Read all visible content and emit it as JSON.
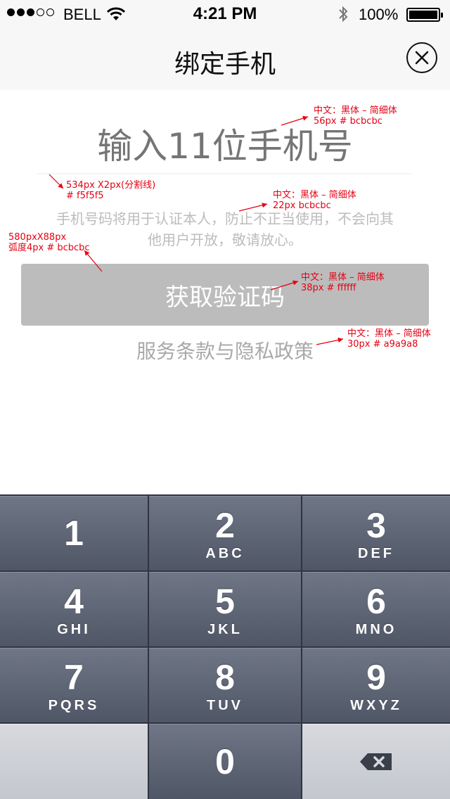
{
  "status_bar": {
    "carrier": "BELL",
    "time": "4:21 PM",
    "battery": "100%",
    "signal_bars": 3,
    "signal_total": 5
  },
  "nav": {
    "title": "绑定手机",
    "close_icon": "close-circle-icon"
  },
  "form": {
    "phone_placeholder": "输入11位手机号",
    "notice_line1": "手机号码将用于认证本人，防止不正当使用，不会向其",
    "notice_line2": "他用户开放，敬请放心。",
    "get_code_label": "获取验证码",
    "terms_label": "服务条款与隐私政策"
  },
  "annotations": {
    "input_line1": "中文：黑体 – 简细体",
    "input_line2": "56px    # bcbcbc",
    "divider_line1": "534px X2px(分割线)",
    "divider_line2": "# f5f5f5",
    "notice_line1": "中文：黑体 – 简细体",
    "notice_line2": "22px     bcbcbc",
    "button_line1": "580pxX88px",
    "button_line2": "弧度4px  # bcbcbc",
    "btn_text_line1": "中文：黑体 – 简细体",
    "btn_text_line2": "38px    # ffffff",
    "terms_line1": "中文：黑体 – 简细体",
    "terms_line2": "30px    # a9a9a8"
  },
  "keypad": {
    "keys": [
      {
        "num": "1",
        "letters": ""
      },
      {
        "num": "2",
        "letters": "ABC"
      },
      {
        "num": "3",
        "letters": "DEF"
      },
      {
        "num": "4",
        "letters": "GHI"
      },
      {
        "num": "5",
        "letters": "JKL"
      },
      {
        "num": "6",
        "letters": "MNO"
      },
      {
        "num": "7",
        "letters": "PQRS"
      },
      {
        "num": "8",
        "letters": "TUV"
      },
      {
        "num": "9",
        "letters": "WXYZ"
      },
      {
        "num": "0",
        "letters": ""
      }
    ],
    "backspace_icon": "backspace-icon"
  },
  "colors": {
    "placeholder": "#bcbcbc",
    "divider": "#f5f5f5",
    "button_bg": "#bcbcbc",
    "button_text": "#ffffff",
    "terms": "#a9a9a9",
    "annotation": "#e60012"
  }
}
